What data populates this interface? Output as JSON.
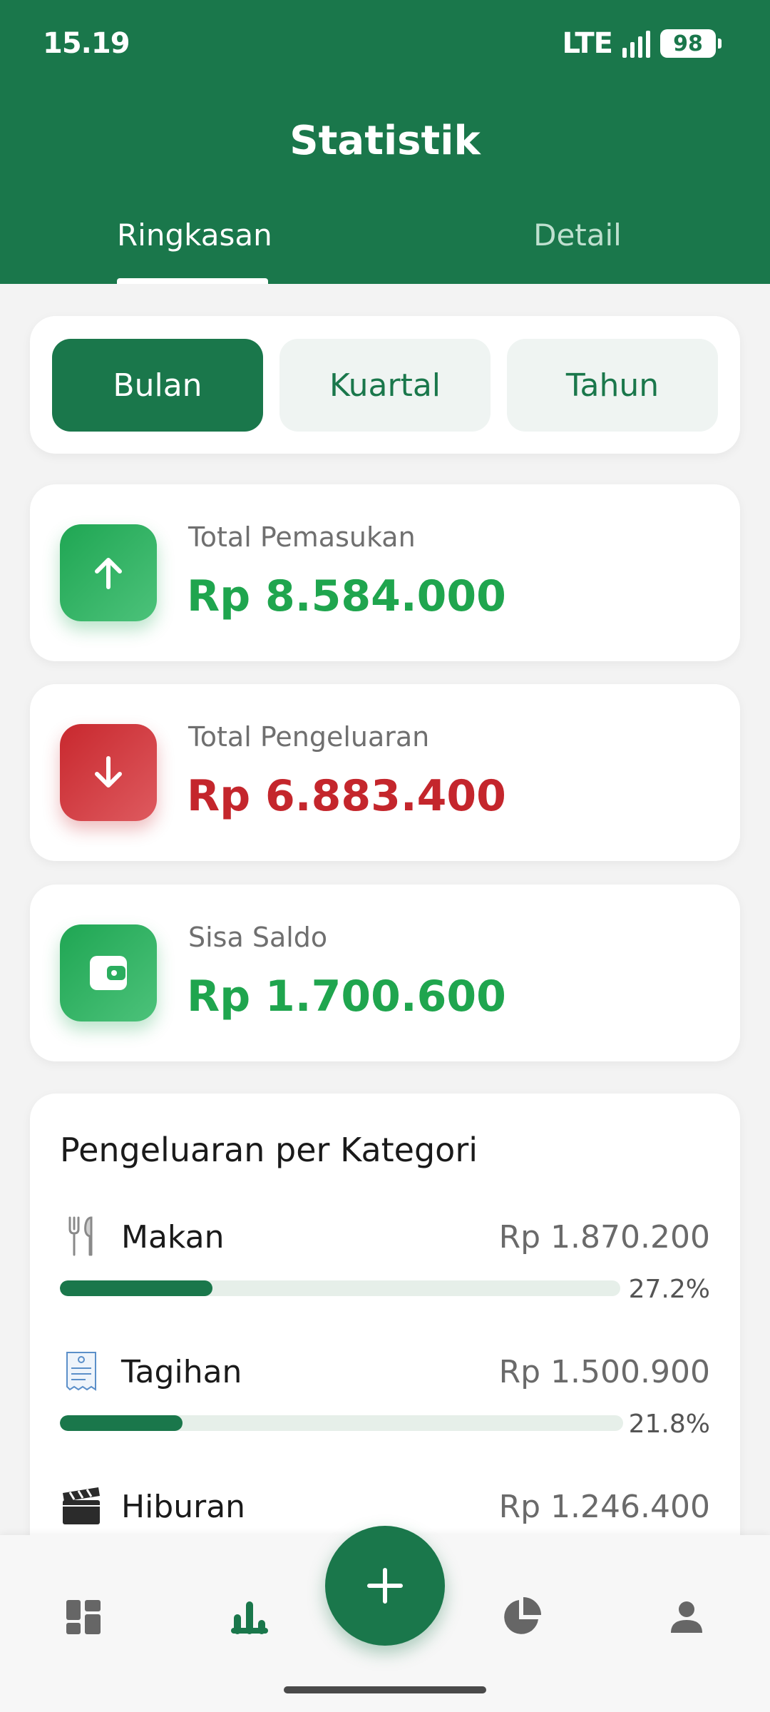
{
  "status_bar": {
    "time": "15.19",
    "network": "LTE",
    "battery": "98"
  },
  "header": {
    "title": "Statistik"
  },
  "tabs": [
    {
      "label": "Ringkasan",
      "active": true
    },
    {
      "label": "Detail",
      "active": false
    }
  ],
  "period": {
    "options": [
      "Bulan",
      "Kuartal",
      "Tahun"
    ],
    "selected": "Bulan"
  },
  "summary": {
    "income": {
      "label": "Total Pemasukan",
      "value": "Rp 8.584.000",
      "icon": "arrow-up-icon"
    },
    "expense": {
      "label": "Total Pengeluaran",
      "value": "Rp 6.883.400",
      "icon": "arrow-down-icon"
    },
    "balance": {
      "label": "Sisa Saldo",
      "value": "Rp 1.700.600",
      "icon": "wallet-icon"
    }
  },
  "categories": {
    "title": "Pengeluaran per Kategori",
    "items": [
      {
        "icon": "fork-knife-icon",
        "name": "Makan",
        "amount": "Rp 1.870.200",
        "percent_label": "27.2%",
        "share": 0.272
      },
      {
        "icon": "receipt-icon",
        "name": "Tagihan",
        "amount": "Rp 1.500.900",
        "percent_label": "21.8%",
        "share": 0.218
      },
      {
        "icon": "clapper-board-icon",
        "name": "Hiburan",
        "amount": "Rp 1.246.400"
      }
    ]
  },
  "bottom_nav": {
    "items": [
      "dashboard-icon",
      "statistics-icon",
      "add-icon",
      "pie-chart-icon",
      "profile-icon"
    ],
    "active": "statistics-icon"
  },
  "colors": {
    "primary": "#1a774b",
    "income": "#1fa54e",
    "expense": "#c4262c",
    "background": "#f3f3f3"
  }
}
